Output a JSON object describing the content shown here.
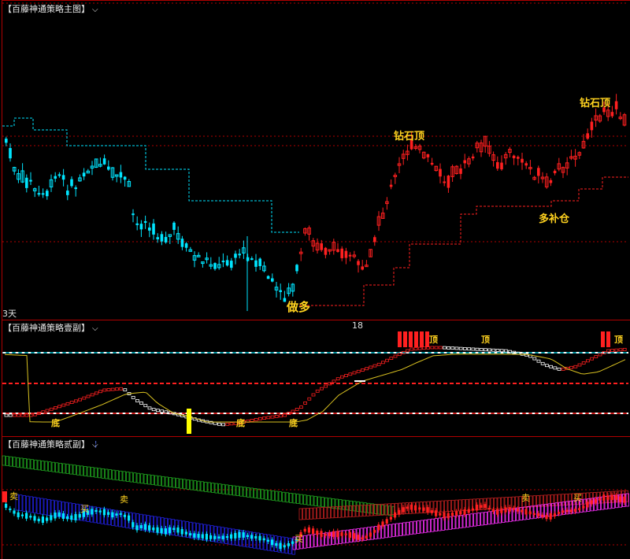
{
  "panels": {
    "main": {
      "title": "【百藤神通策略主图】"
    },
    "sub1": {
      "title": "【百藤神通策略壹副】",
      "value": "18"
    },
    "sub2": {
      "title": "【百藤神通策略贰副】"
    }
  },
  "period_label": "3天",
  "annotations": {
    "zuan_shi_ding_1": "钻石顶",
    "zuan_shi_ding_2": "钻石顶",
    "duo_bu_cang": "多补仓",
    "zuo_duo": "做多"
  },
  "sub1_markers": {
    "di_1": "底",
    "di_2": "底",
    "di_3": "底",
    "ding_1": "顶",
    "ding_2": "顶",
    "ding_3": "顶"
  },
  "sub2_markers": {
    "mai_sell_1": "卖",
    "mai_buy_1": "买",
    "mai_sell_2": "卖",
    "mai_buy_2": "买",
    "mai_sell_3": "卖",
    "mai_buy_3": "买"
  },
  "colors": {
    "up": "#ff2020",
    "down": "#00e5ff",
    "yellow": "#ffd21f",
    "green": "#1fa51f",
    "blue": "#2020e0",
    "magenta": "#ff30ff",
    "white": "#ffffff"
  },
  "chart_data": {
    "type": "candlestick",
    "candles": []
  }
}
